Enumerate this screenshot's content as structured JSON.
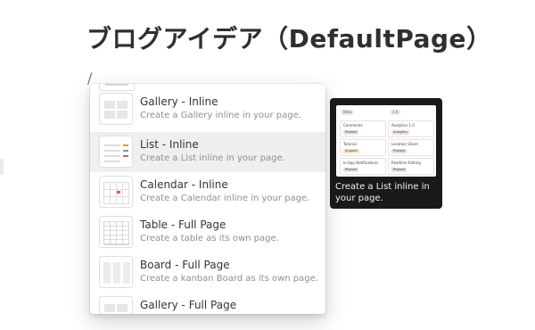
{
  "page": {
    "title": "ブログアイデア（DefaultPage）",
    "typed_text": "/"
  },
  "menu": {
    "items": [
      {
        "label": "Gallery - Inline",
        "description": "Create a Gallery inline in your page.",
        "icon": "gallery-icon"
      },
      {
        "label": "List - Inline",
        "description": "Create a List inline in your page.",
        "icon": "list-icon",
        "selected": true
      },
      {
        "label": "Calendar - Inline",
        "description": "Create a Calendar inline in your page.",
        "icon": "calendar-icon"
      },
      {
        "label": "Table - Full Page",
        "description": "Create a table as its own page.",
        "icon": "table-icon"
      },
      {
        "label": "Board - Full Page",
        "description": "Create a kanban Board as its own page.",
        "icon": "board-icon"
      },
      {
        "label": "Gallery - Full Page",
        "description": "",
        "icon": "gallery-icon"
      }
    ]
  },
  "preview": {
    "caption": "Create a List inline in your page.",
    "header_chips": [
      "Beta",
      "1.0"
    ],
    "cards": [
      {
        "title": "Comments",
        "tag": "Product"
      },
      {
        "title": "Analytics 1.0",
        "tag": "Analytics"
      },
      {
        "title": "Tutorial",
        "tag": "Support"
      },
      {
        "title": "Location Share",
        "tag": "Product"
      },
      {
        "title": "In-App Notifications",
        "tag": "Product"
      },
      {
        "title": "Realtime Editing",
        "tag": "Product"
      }
    ],
    "colors": {
      "background": "#191919",
      "product_tag": "#dde3f3",
      "analytics_tag": "#f6dde8",
      "support_tag": "#fbe3cf"
    }
  }
}
